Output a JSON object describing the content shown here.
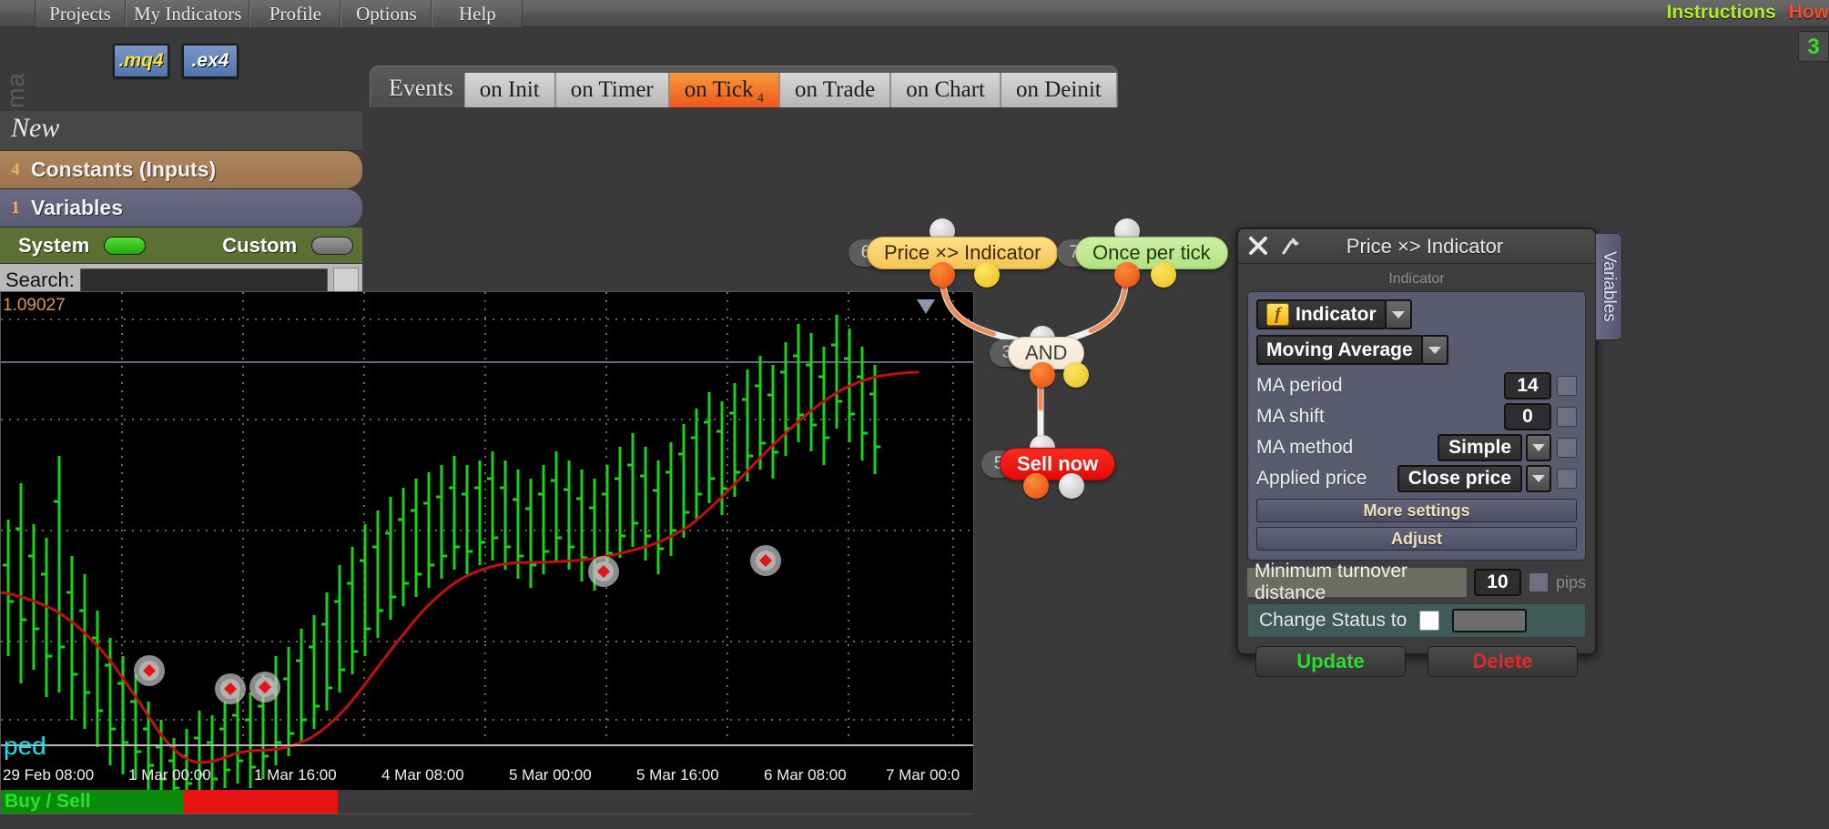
{
  "app": {
    "watermark": "fxdreema"
  },
  "menu": {
    "items": [
      {
        "label": "Projects"
      },
      {
        "label": "My Indicators"
      },
      {
        "label": "Profile"
      },
      {
        "label": "Options"
      },
      {
        "label": "Help"
      }
    ]
  },
  "toplinks": {
    "instructions": "Instructions",
    "how": "How",
    "instructions_color": "#aef12a",
    "how_color": "#f2512a",
    "badge": "3",
    "badge_color": "#36e02a"
  },
  "filebuttons": {
    "mq4": ".mq4",
    "ex4": ".ex4"
  },
  "events": {
    "label": "Events",
    "tabs": [
      {
        "label": "on Init",
        "active": false,
        "sub": ""
      },
      {
        "label": "on Timer",
        "active": false,
        "sub": ""
      },
      {
        "label": "on Tick",
        "active": true,
        "sub": "4"
      },
      {
        "label": "on Trade",
        "active": false,
        "sub": ""
      },
      {
        "label": "on Chart",
        "active": false,
        "sub": ""
      },
      {
        "label": "on Deinit",
        "active": false,
        "sub": ""
      }
    ]
  },
  "sidebar": {
    "new_label": "New",
    "constants": {
      "count": "4",
      "label": "Constants (Inputs)"
    },
    "variables": {
      "count": "1",
      "label": "Variables"
    },
    "system_label": "System",
    "system_state": "on",
    "custom_label": "Custom",
    "custom_state": "off",
    "search_label": "Search:",
    "search_value": "",
    "search_placeholder": ""
  },
  "nodes": [
    {
      "index": "6",
      "label": "Price ×> Indicator",
      "color": "yellow"
    },
    {
      "index": "7",
      "label": "Once per tick",
      "color": "green"
    },
    {
      "index": "3",
      "label": "AND",
      "color": "cream"
    },
    {
      "index": "5",
      "label": "Sell now",
      "color": "red"
    }
  ],
  "panel": {
    "title": "Price ×> Indicator",
    "close_icon": "close-icon",
    "pin_icon": "pin-icon",
    "section_label": "Indicator",
    "indicator_type": "Indicator",
    "indicator_name": "Moving Average",
    "fields": [
      {
        "label": "MA period",
        "value": "14",
        "kind": "number"
      },
      {
        "label": "MA shift",
        "value": "0",
        "kind": "number"
      },
      {
        "label": "MA method",
        "value": "Simple",
        "kind": "select"
      },
      {
        "label": "Applied price",
        "value": "Close price",
        "kind": "select"
      }
    ],
    "more_settings": "More settings",
    "adjust": "Adjust",
    "min_turnover_label": "Minimum turnover distance",
    "min_turnover_value": "10",
    "pips_label": "pips",
    "change_status_label": "Change Status to",
    "change_status_value": "",
    "update_label": "Update",
    "delete_label": "Delete",
    "update_color": "#2cdc2c",
    "delete_color": "#e22a2a",
    "variables_tab": "Variables"
  },
  "chart_data": {
    "type": "line",
    "title": "",
    "xlabel": "",
    "ylabel": "",
    "price_label": "1.09027",
    "truncated_label": "ped",
    "legend": [],
    "grid": true,
    "xticks": [
      "29 Feb 08:00",
      "1 Mar 00:00",
      "1 Mar 16:00",
      "4 Mar 08:00",
      "5 Mar 00:00",
      "5 Mar 16:00",
      "6 Mar 08:00",
      "7 Mar 00:0"
    ],
    "series": [
      {
        "name": "Price bars",
        "type": "ohlc-bars",
        "color": "#17d417",
        "values": [
          1.0878,
          1.0861,
          1.0852,
          1.0844,
          1.0871,
          1.0855,
          1.0849,
          1.0836,
          1.0822,
          1.0814,
          1.0806,
          1.0791,
          1.0778,
          1.0762,
          1.0746,
          1.0739,
          1.0728,
          1.0736,
          1.0744,
          1.0735,
          1.0741,
          1.0752,
          1.0747,
          1.0739,
          1.0743,
          1.0757,
          1.0768,
          1.0779,
          1.0791,
          1.0804,
          1.0816,
          1.0829,
          1.0841,
          1.0852,
          1.0861,
          1.0869,
          1.0874,
          1.0867,
          1.0872,
          1.0881,
          1.0876,
          1.0869,
          1.0863,
          1.0871,
          1.0884,
          1.0879,
          1.0872,
          1.0866,
          1.0874,
          1.0886,
          1.0894,
          1.0887,
          1.0879,
          1.0891,
          1.0903,
          1.0916,
          1.0928,
          1.0941,
          1.0936,
          1.0949,
          1.0962,
          1.0974,
          1.0967,
          1.0981,
          1.0993,
          1.0987,
          1.0979,
          1.0991,
          1.0903
        ]
      },
      {
        "name": "Moving Average (14)",
        "type": "line",
        "color": "#c01010",
        "values": [
          1.0869,
          1.0864,
          1.0858,
          1.0851,
          1.0845,
          1.0838,
          1.083,
          1.0821,
          1.0812,
          1.0803,
          1.0794,
          1.0785,
          1.0776,
          1.0768,
          1.076,
          1.0753,
          1.0748,
          1.0745,
          1.0744,
          1.0744,
          1.0745,
          1.0747,
          1.0749,
          1.0751,
          1.0754,
          1.0759,
          1.0765,
          1.0772,
          1.078,
          1.0789,
          1.0798,
          1.0808,
          1.0817,
          1.0826,
          1.0834,
          1.0841,
          1.0847,
          1.0851,
          1.0855,
          1.0858,
          1.086,
          1.0861,
          1.0862,
          1.0864,
          1.0866,
          1.0868,
          1.0869,
          1.0871,
          1.0874,
          1.0877,
          1.0881,
          1.0884,
          1.0887,
          1.0891,
          1.0896,
          1.0902,
          1.0909,
          1.0917,
          1.0924,
          1.0932,
          1.094,
          1.0948,
          1.0955,
          1.0963,
          1.0971,
          1.0977,
          1.0982,
          1.0987,
          1.0991
        ]
      }
    ],
    "markers": [
      {
        "x": 0.152,
        "y": 0.726,
        "label": "sell-signal"
      },
      {
        "x": 0.232,
        "y": 0.759,
        "label": "sell-signal"
      },
      {
        "x": 0.267,
        "y": 0.757,
        "label": "sell-signal"
      },
      {
        "x": 0.61,
        "y": 0.555,
        "label": "sell-signal"
      },
      {
        "x": 0.775,
        "y": 0.528,
        "label": "sell-signal"
      }
    ],
    "buysell_label": "Buy / Sell"
  }
}
